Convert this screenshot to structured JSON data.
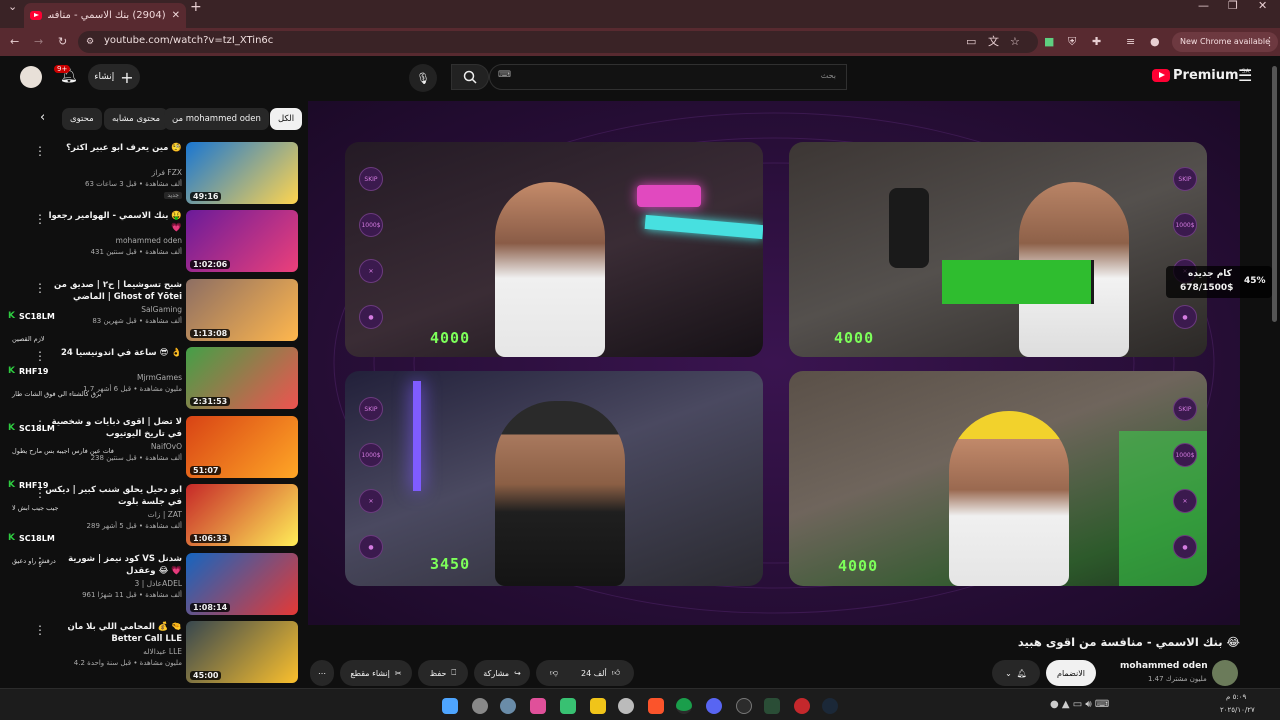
{
  "browser": {
    "tab_title": "(2904) بنك الاسمي - منافسة",
    "url": "youtube.com/watch?v=tzI_XTin6c",
    "new_chrome_label": "New Chrome available"
  },
  "header": {
    "create_label": "إنشاء",
    "notif_count": "9+",
    "search_placeholder": "بحث",
    "logo_text": "Premium",
    "region": "SA"
  },
  "chips": [
    "الكل",
    "من mohammed oden",
    "محتوى مشابه",
    "محتوى"
  ],
  "recommendations": [
    {
      "title": "مين يعرف ابو عبير اكثر؟ 🧐",
      "channel": "فراز FZX",
      "meta": "63 ألف مشاهدة • قبل 3 ساعات",
      "duration": "49:16",
      "badge": "جديد"
    },
    {
      "title": "بنك الاسمي - الهوامير رجعوا 🤑 💗",
      "channel": "mohammed oden",
      "meta": "431 ألف مشاهدة • قبل سنتين",
      "duration": "1:02:06"
    },
    {
      "title": "شبح تسوشيما | ح٢ | صديق من الماضي | Ghost of Yōtei",
      "channel": "SalGaming",
      "meta": "83 ألف مشاهدة • قبل شهرين",
      "duration": "1:13:08"
    },
    {
      "title": "24 ساعة في اندونيسيا 😎 👌",
      "channel": "MjrmGames",
      "meta": "1.7 مليون مشاهدة • قبل 6 أشهر",
      "duration": "2:31:53"
    },
    {
      "title": "لا تضل | اقوى ذبايات و شخصية في تاريخ اليوتيوب",
      "channel": "NaifOvO",
      "meta": "238 ألف مشاهدة • قبل سنتين",
      "duration": "51:07"
    },
    {
      "title": "ابو دحيل يحلق شنب كبير | ديكس في جلسة بلوت",
      "channel": "زات | ZAT",
      "meta": "289 ألف مشاهدة • قبل 5 أشهر",
      "duration": "1:06:33"
    },
    {
      "title": "كود نيمز | شورية VS شدنل وعقدل 😂 💗",
      "channel": "عادل | 3ADEL",
      "meta": "961 ألف مشاهدة • قبل 11 شهرًا",
      "duration": "1:08:14"
    },
    {
      "title": "المحامي اللي بلا مان 💰 🤏 Better Call LLE",
      "channel": "عبدالاله LLE",
      "meta": "4.2 مليون مشاهدة • قبل سنة واحدة",
      "duration": "45:00"
    }
  ],
  "chat": [
    {
      "name": "SC18LM",
      "msg": "لازم القصين"
    },
    {
      "name": "RHF19",
      "msg": "برق كالشتاء الي فوق الشات طار"
    },
    {
      "name": "SC18LM",
      "msg": "فات عين فارس اجيبه بس مارح يطول"
    },
    {
      "name": "RHF19",
      "msg": "جيب جيب ابش لا"
    },
    {
      "name": "SC18LM",
      "msg": "درقش راو دعيق"
    }
  ],
  "player": {
    "scores": [
      "4000",
      "4000",
      "3450",
      "4000"
    ],
    "goal_title": "كام جديده",
    "goal_progress": "678/1500$",
    "goal_percent": "45%",
    "goal_fraction": 0.45,
    "skip_label": "SKIP",
    "money_label": "1000$"
  },
  "video": {
    "title": "بنك الاسمي - منافسة من اقوى هبيد 😂",
    "channel": "mohammed oden",
    "subscribers": "1.47 مليون مشترك",
    "join_label": "الانضمام",
    "likes": "24 ألف",
    "share_label": "مشاركة",
    "save_label": "حفظ",
    "clip_label": "إنشاء مقطع"
  },
  "taskbar": {
    "time": "٥:٠٩ م",
    "date": "٢٠٢٥/١٠/٢٧"
  }
}
